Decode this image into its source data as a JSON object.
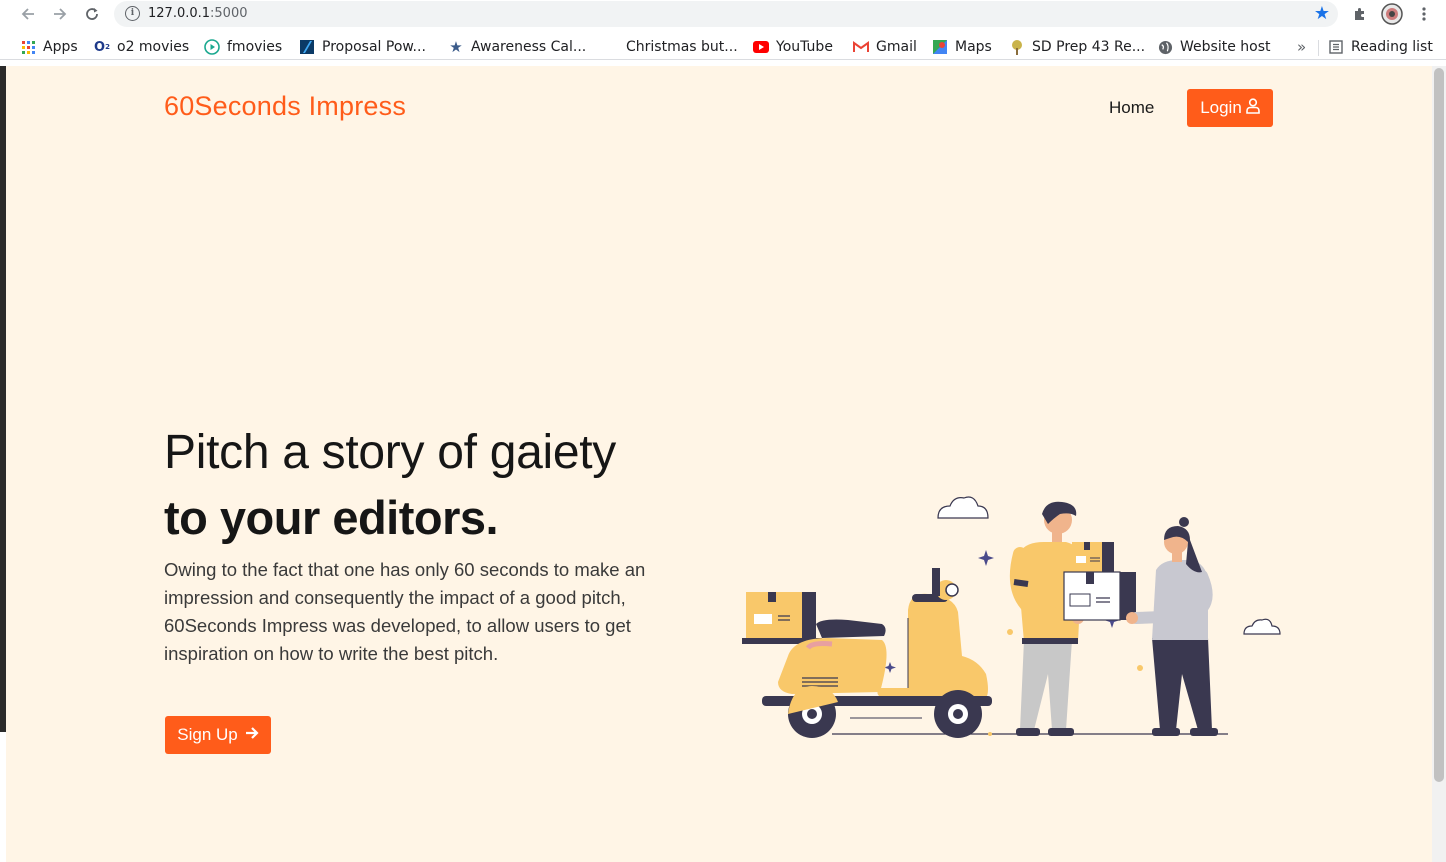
{
  "browser": {
    "url_host": "127.0.0.1",
    "url_port": ":5000",
    "bookmarks": [
      {
        "label": "Apps",
        "icon": "apps-grid-icon"
      },
      {
        "label": "o2 movies",
        "icon": "o2-icon"
      },
      {
        "label": "fmovies",
        "icon": "play-circle-icon"
      },
      {
        "label": "Proposal Pow...",
        "icon": "proposal-icon"
      },
      {
        "label": "Awareness Cal...",
        "icon": "star-icon"
      },
      {
        "label": "Christmas but...",
        "icon": ""
      },
      {
        "label": "YouTube",
        "icon": "youtube-icon"
      },
      {
        "label": "Gmail",
        "icon": "gmail-icon"
      },
      {
        "label": "Maps",
        "icon": "maps-icon"
      },
      {
        "label": "SD Prep 43 Re...",
        "icon": "tree-icon"
      },
      {
        "label": "Website host",
        "icon": "globe-icon"
      }
    ],
    "overflow": "»",
    "reading_list": "Reading list"
  },
  "page": {
    "brand": "60Seconds Impress",
    "nav": {
      "home": "Home",
      "login": "Login"
    },
    "hero": {
      "title": "Pitch a story of gaiety",
      "title_bold": "to your editors.",
      "description": "Owing to the fact that one has only 60 seconds to make an impression and consequently the impact of a good pitch, 60Seconds Impress was developed, to allow users to get inspiration on how to write the best pitch.",
      "signup": "Sign Up"
    }
  },
  "colors": {
    "accent": "#ff5c1a",
    "background": "#fff5e6",
    "scooter": "#f9c86a",
    "dark": "#3a3850"
  }
}
